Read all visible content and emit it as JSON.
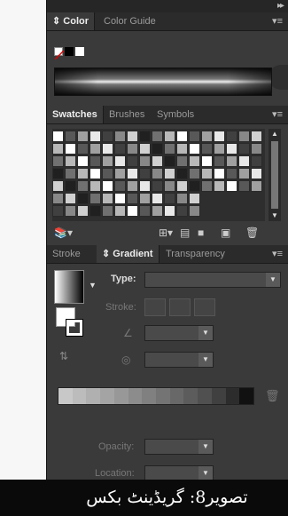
{
  "color_panel": {
    "tabs": [
      {
        "label": "Color",
        "icon": "updown-icon",
        "active": true
      },
      {
        "label": "Color Guide",
        "active": false
      }
    ],
    "menu_icon": "panel-menu-icon"
  },
  "swatches_panel": {
    "tabs": [
      {
        "label": "Swatches",
        "active": true
      },
      {
        "label": "Brushes",
        "active": false
      },
      {
        "label": "Symbols",
        "active": false
      }
    ],
    "menu_icon": "panel-menu-icon",
    "toolbar": [
      "swatch-libraries-icon",
      "show-kinds-icon",
      "swatch-options-icon",
      "new-group-icon",
      "new-swatch-icon",
      "delete-icon"
    ]
  },
  "gradient_panel": {
    "tabs": [
      {
        "label": "Stroke",
        "active": false
      },
      {
        "label": "Gradient",
        "icon": "updown-icon",
        "active": true
      },
      {
        "label": "Transparency",
        "active": false
      }
    ],
    "type_label": "Type:",
    "stroke_label": "Stroke:",
    "opacity_label": "Opacity:",
    "location_label": "Location:",
    "gradient_stops": [
      "#c8c8c8",
      "#bcbcbc",
      "#b0b0b0",
      "#a4a4a4",
      "#989898",
      "#8c8c8c",
      "#808080",
      "#747474",
      "#686868",
      "#5c5c5c",
      "#505050",
      "#404040",
      "#2c2c2c",
      "#111111"
    ]
  },
  "caption": "تصویر8: گریڈینٹ بکس"
}
